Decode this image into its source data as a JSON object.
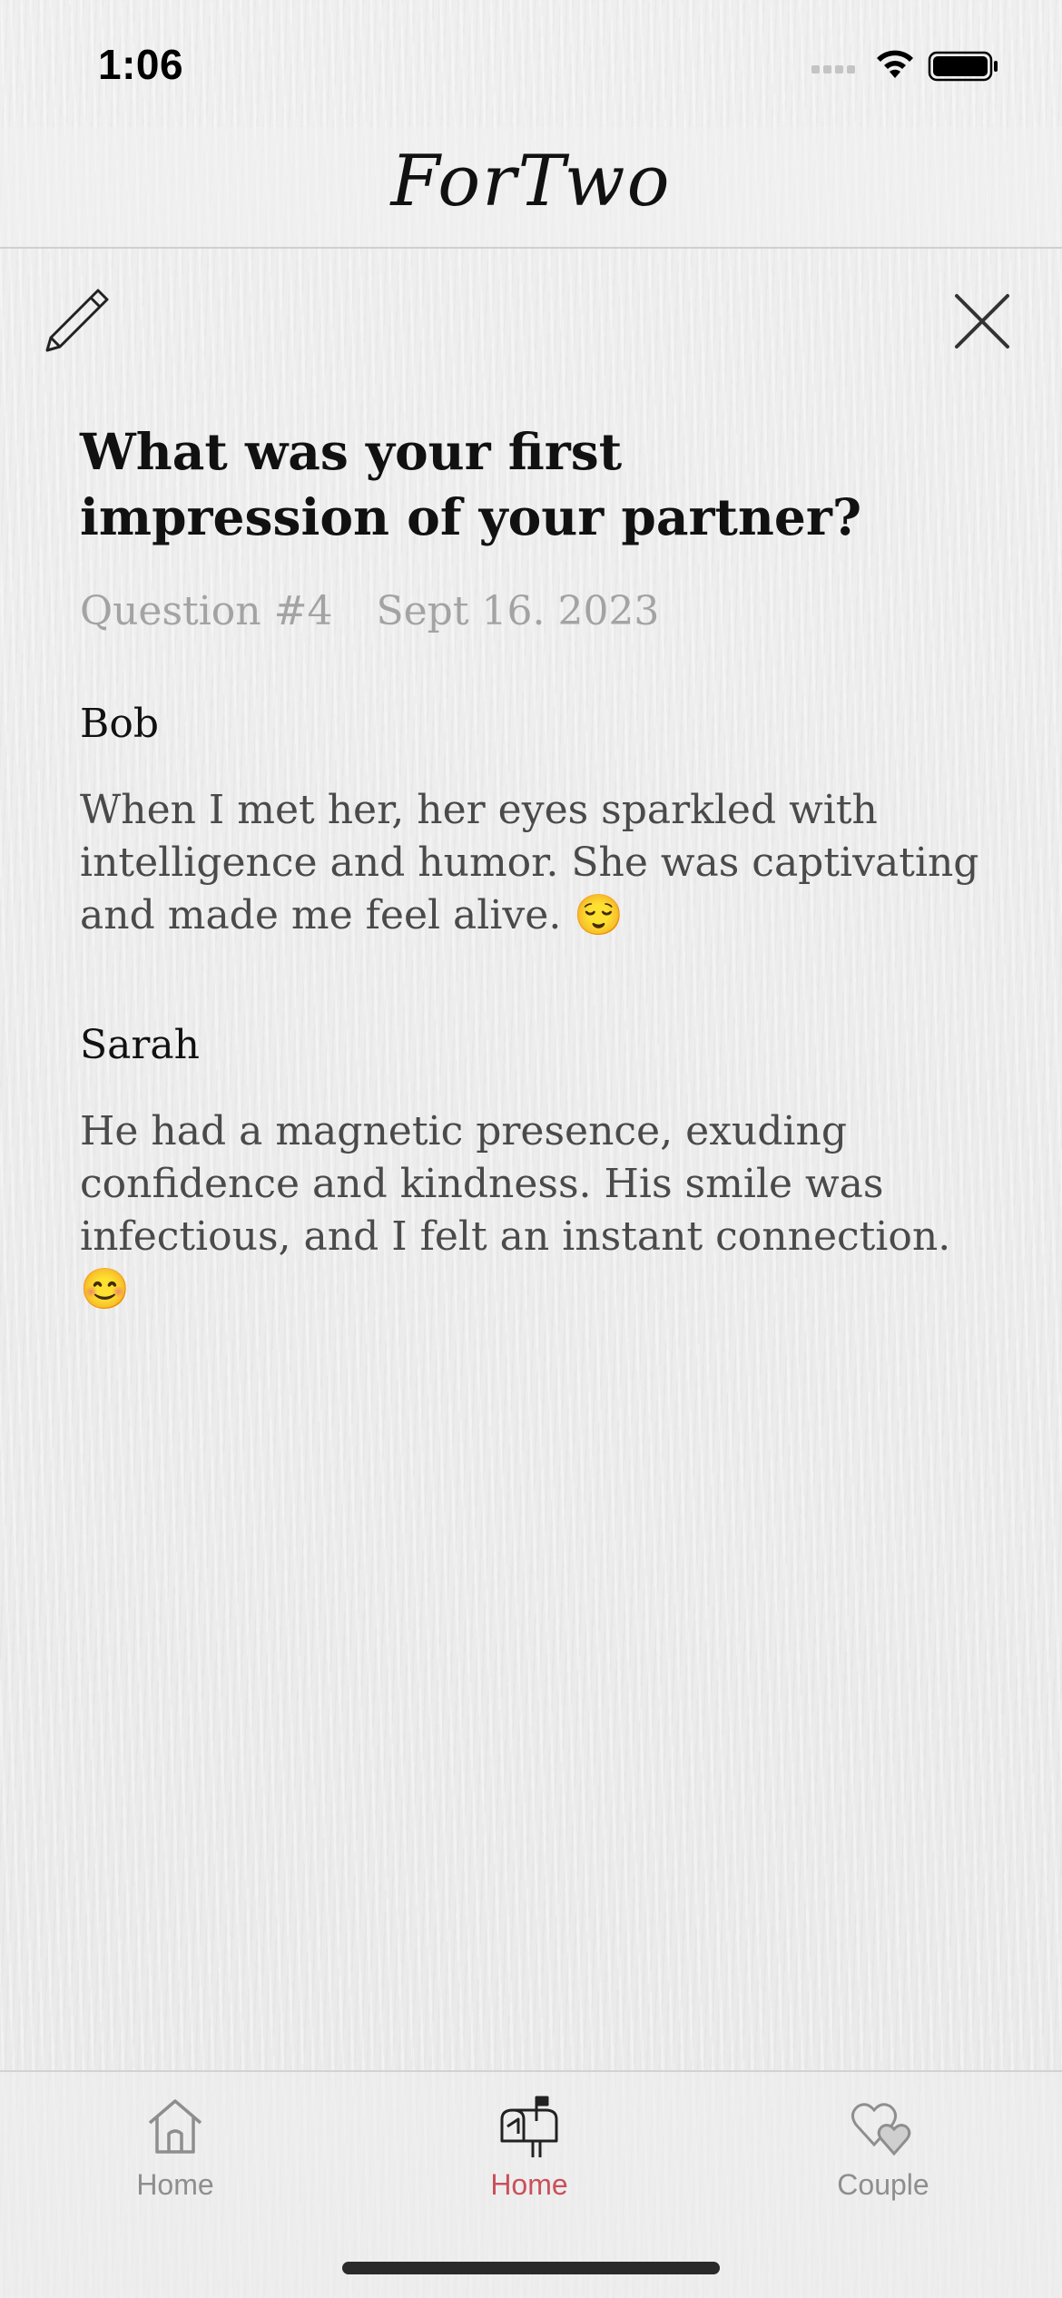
{
  "status_bar": {
    "time": "1:06",
    "icons": [
      "signal-icon",
      "wifi-icon",
      "battery-icon"
    ]
  },
  "header": {
    "title": "ForTwo"
  },
  "toolbar": {
    "edit_icon": "pencil-icon",
    "close_icon": "close-icon"
  },
  "question": {
    "title": "What was your first impression of your partner?",
    "number": "Question #4",
    "date": "Sept 16. 2023"
  },
  "answers": [
    {
      "name": "Bob",
      "text": "When I met her, her eyes sparkled with intelligence and humor. She was captivating and made me feel alive. 😌"
    },
    {
      "name": "Sarah",
      "text": "He had a magnetic presence, exuding confidence and kindness. His smile was infectious, and I felt an instant connection. 😊"
    }
  ],
  "tab_bar": {
    "items": [
      {
        "label": "Home",
        "icon": "house-icon",
        "active": false
      },
      {
        "label": "Home",
        "icon": "mailbox-icon",
        "active": true
      },
      {
        "label": "Couple",
        "icon": "hearts-icon",
        "active": false
      }
    ],
    "active_color": "#c9505a",
    "inactive_color": "#8e8e8e"
  }
}
